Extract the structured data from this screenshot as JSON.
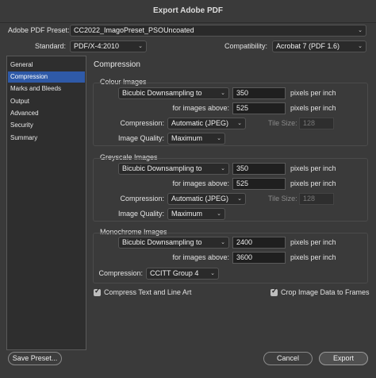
{
  "window": {
    "title": "Export Adobe PDF"
  },
  "top": {
    "preset_label": "Adobe PDF Preset:",
    "preset_value": "CC2022_ImagoPreset_PSOUncoated",
    "standard_label": "Standard:",
    "standard_value": "PDF/X-4:2010",
    "compat_label": "Compatibility:",
    "compat_value": "Acrobat 7 (PDF 1.6)"
  },
  "sidebar": {
    "items": [
      {
        "label": "General"
      },
      {
        "label": "Compression"
      },
      {
        "label": "Marks and Bleeds"
      },
      {
        "label": "Output"
      },
      {
        "label": "Advanced"
      },
      {
        "label": "Security"
      },
      {
        "label": "Summary"
      }
    ],
    "active_index": 1
  },
  "main": {
    "heading": "Compression",
    "colour": {
      "title": "Colour Images",
      "sampling": "Bicubic Downsampling to",
      "ppi_value": "350",
      "ppi_unit": "pixels per inch",
      "above_label": "for images above:",
      "above_value": "525",
      "above_unit": "pixels per inch",
      "compression_label": "Compression:",
      "compression_value": "Automatic (JPEG)",
      "tile_label": "Tile Size:",
      "tile_value": "128",
      "quality_label": "Image Quality:",
      "quality_value": "Maximum"
    },
    "greyscale": {
      "title": "Greyscale Images",
      "sampling": "Bicubic Downsampling to",
      "ppi_value": "350",
      "ppi_unit": "pixels per inch",
      "above_label": "for images above:",
      "above_value": "525",
      "above_unit": "pixels per inch",
      "compression_label": "Compression:",
      "compression_value": "Automatic (JPEG)",
      "tile_label": "Tile Size:",
      "tile_value": "128",
      "quality_label": "Image Quality:",
      "quality_value": "Maximum"
    },
    "mono": {
      "title": "Monochrome Images",
      "sampling": "Bicubic Downsampling to",
      "ppi_value": "2400",
      "ppi_unit": "pixels per inch",
      "above_label": "for images above:",
      "above_value": "3600",
      "above_unit": "pixels per inch",
      "compression_label": "Compression:",
      "compression_value": "CCITT Group 4"
    },
    "compress_text": {
      "label": "Compress Text and Line Art",
      "checked": true
    },
    "crop_image": {
      "label": "Crop Image Data to Frames",
      "checked": true
    }
  },
  "buttons": {
    "save_preset": "Save Preset...",
    "cancel": "Cancel",
    "export": "Export"
  },
  "icons": {
    "chevron": "⌄",
    "check": "✓"
  }
}
